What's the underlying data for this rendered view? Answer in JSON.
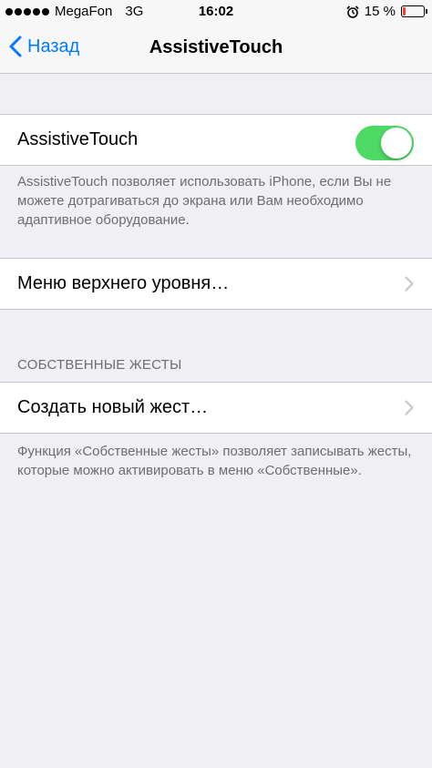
{
  "status_bar": {
    "carrier": "MegaFon",
    "network": "3G",
    "time": "16:02",
    "battery_percent_label": "15 %",
    "battery_level": 0.15,
    "battery_color": "#ff3b30",
    "signal_bars": 5,
    "alarm_icon": "alarm-clock-icon"
  },
  "nav": {
    "back_label": "Назад",
    "title": "AssistiveTouch"
  },
  "assistive_touch": {
    "label": "AssistiveTouch",
    "toggle_on": true,
    "toggle_color": "#4cd964",
    "footer": "AssistiveTouch позволяет использовать iPhone, если Вы не можете дотрагиваться до экрана или Вам необходимо адаптивное оборудование."
  },
  "top_level_menu": {
    "label": "Меню верхнего уровня…"
  },
  "custom_gestures": {
    "header": "СОБСТВЕННЫЕ ЖЕСТЫ",
    "create_label": "Создать новый жест…",
    "footer": "Функция «Собственные жесты» позволяет записывать жесты, которые можно активировать в меню «Собственные»."
  },
  "accent_color": "#007aff"
}
